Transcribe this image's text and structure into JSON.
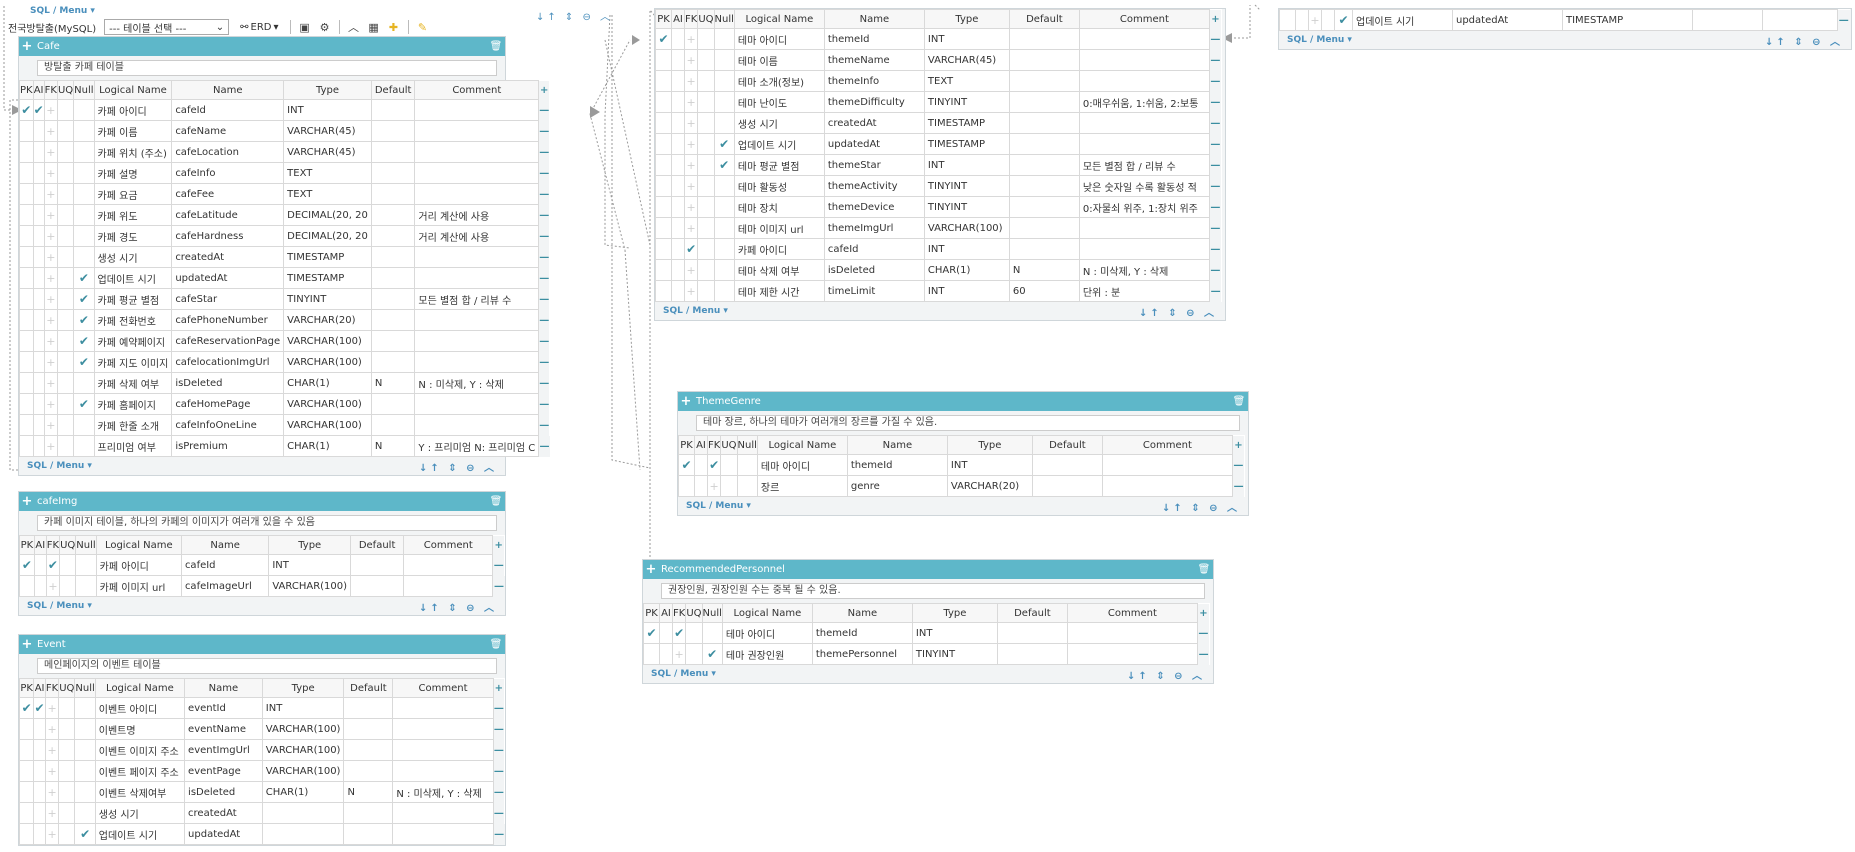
{
  "toolbar": {
    "top_sql_menu": "SQL / Menu",
    "db_label": "전국방탈출(MySQL)",
    "table_select": "--- 테이블 선택 ---",
    "erd_label": "ERD"
  },
  "columns": {
    "pk": "PK",
    "ai": "AI",
    "fk": "FK",
    "uq": "UQ",
    "null": "Null",
    "logical": "Logical Name",
    "name": "Name",
    "type": "Type",
    "default": "Default",
    "comment": "Comment"
  },
  "footer": {
    "sql_menu": "SQL / Menu"
  },
  "tables": {
    "cafe": {
      "name": "Cafe",
      "desc": "방탈출 카페 테이블",
      "rows": [
        {
          "pk": true,
          "ai": true,
          "fk": false,
          "nn": false,
          "logical": "카페 아이디",
          "name": "cafeId",
          "type": "INT",
          "default": "",
          "comment": ""
        },
        {
          "pk": false,
          "ai": false,
          "fk": false,
          "nn": false,
          "logical": "카페 이름",
          "name": "cafeName",
          "type": "VARCHAR(45)",
          "default": "",
          "comment": ""
        },
        {
          "pk": false,
          "ai": false,
          "fk": false,
          "nn": false,
          "logical": "카페 위치 (주소)",
          "name": "cafeLocation",
          "type": "VARCHAR(45)",
          "default": "",
          "comment": ""
        },
        {
          "pk": false,
          "ai": false,
          "fk": false,
          "nn": false,
          "logical": "카페 설명",
          "name": "cafeInfo",
          "type": "TEXT",
          "default": "",
          "comment": ""
        },
        {
          "pk": false,
          "ai": false,
          "fk": false,
          "nn": false,
          "logical": "카페 요금",
          "name": "cafeFee",
          "type": "TEXT",
          "default": "",
          "comment": ""
        },
        {
          "pk": false,
          "ai": false,
          "fk": false,
          "nn": false,
          "logical": "카페 위도",
          "name": "cafeLatitude",
          "type": "DECIMAL(20, 20",
          "default": "",
          "comment": "거리 계산에 사용"
        },
        {
          "pk": false,
          "ai": false,
          "fk": false,
          "nn": false,
          "logical": "카페 경도",
          "name": "cafeHardness",
          "type": "DECIMAL(20, 20",
          "default": "",
          "comment": "거리 계산에 사용"
        },
        {
          "pk": false,
          "ai": false,
          "fk": false,
          "nn": false,
          "logical": "생성 시기",
          "name": "createdAt",
          "type": "TIMESTAMP",
          "default": "",
          "comment": ""
        },
        {
          "pk": false,
          "ai": false,
          "fk": false,
          "nn": true,
          "logical": "업데이트 시기",
          "name": "updatedAt",
          "type": "TIMESTAMP",
          "default": "",
          "comment": ""
        },
        {
          "pk": false,
          "ai": false,
          "fk": false,
          "nn": true,
          "logical": "카페 평균 별점",
          "name": "cafeStar",
          "type": "TINYINT",
          "default": "",
          "comment": "모든 별점 합 / 리뷰 수"
        },
        {
          "pk": false,
          "ai": false,
          "fk": false,
          "nn": true,
          "logical": "카페 전화번호",
          "name": "cafePhoneNumber",
          "type": "VARCHAR(20)",
          "default": "",
          "comment": ""
        },
        {
          "pk": false,
          "ai": false,
          "fk": false,
          "nn": true,
          "logical": "카페 예약페이지",
          "name": "cafeReservationPage",
          "type": "VARCHAR(100)",
          "default": "",
          "comment": ""
        },
        {
          "pk": false,
          "ai": false,
          "fk": false,
          "nn": true,
          "logical": "카페 지도 이미지",
          "name": "cafelocationImgUrl",
          "type": "VARCHAR(100)",
          "default": "",
          "comment": ""
        },
        {
          "pk": false,
          "ai": false,
          "fk": false,
          "nn": false,
          "logical": "카페 삭제 여부",
          "name": "isDeleted",
          "type": "CHAR(1)",
          "default": "N",
          "comment": "N : 미삭제, Y : 삭제"
        },
        {
          "pk": false,
          "ai": false,
          "fk": false,
          "nn": true,
          "logical": "카페 홈페이지",
          "name": "cafeHomePage",
          "type": "VARCHAR(100)",
          "default": "",
          "comment": ""
        },
        {
          "pk": false,
          "ai": false,
          "fk": false,
          "nn": false,
          "logical": "카페 한줄 소개",
          "name": "cafeInfoOneLine",
          "type": "VARCHAR(100)",
          "default": "",
          "comment": ""
        },
        {
          "pk": false,
          "ai": false,
          "fk": false,
          "nn": false,
          "logical": "프리미엄 여부",
          "name": "isPremium",
          "type": "CHAR(1)",
          "default": "N",
          "comment": "Y : 프리미엄 N: 프리미엄 C"
        }
      ]
    },
    "cafeimg": {
      "name": "cafeImg",
      "desc": "카페 이미지 테이블, 하나의 카페의 이미지가 여러개 있을 수 있음",
      "rows": [
        {
          "pk": true,
          "ai": false,
          "fk": true,
          "nn": false,
          "logical": "카페 아이디",
          "name": "cafeId",
          "type": "INT",
          "default": "",
          "comment": ""
        },
        {
          "pk": false,
          "ai": false,
          "fk": false,
          "nn": false,
          "logical": "카페 이미지 url",
          "name": "cafeImageUrl",
          "type": "VARCHAR(100)",
          "default": "",
          "comment": ""
        }
      ]
    },
    "event": {
      "name": "Event",
      "desc": "메인페이지의 이벤트 테이블",
      "rows": [
        {
          "pk": true,
          "ai": true,
          "fk": false,
          "nn": false,
          "logical": "이벤트 아이디",
          "name": "eventId",
          "type": "INT",
          "default": "",
          "comment": ""
        },
        {
          "pk": false,
          "ai": false,
          "fk": false,
          "nn": false,
          "logical": "이벤트명",
          "name": "eventName",
          "type": "VARCHAR(100)",
          "default": "",
          "comment": ""
        },
        {
          "pk": false,
          "ai": false,
          "fk": false,
          "nn": false,
          "logical": "이벤트 이미지 주소",
          "name": "eventImgUrl",
          "type": "VARCHAR(100)",
          "default": "",
          "comment": ""
        },
        {
          "pk": false,
          "ai": false,
          "fk": false,
          "nn": false,
          "logical": "이벤트 페이지 주소",
          "name": "eventPage",
          "type": "VARCHAR(100)",
          "default": "",
          "comment": ""
        },
        {
          "pk": false,
          "ai": false,
          "fk": false,
          "nn": false,
          "logical": "이벤트 삭제여부",
          "name": "isDeleted",
          "type": "CHAR(1)",
          "default": "N",
          "comment": "N : 미삭제, Y : 삭제"
        },
        {
          "pk": false,
          "ai": false,
          "fk": false,
          "nn": false,
          "logical": "생성 시기",
          "name": "createdAt",
          "type": "",
          "default": "",
          "comment": ""
        },
        {
          "pk": false,
          "ai": false,
          "fk": false,
          "nn": true,
          "logical": "업데이트 시기",
          "name": "updatedAt",
          "type": "",
          "default": "",
          "comment": ""
        }
      ]
    },
    "theme": {
      "rows": [
        {
          "pk": true,
          "ai": false,
          "fk": false,
          "nn": false,
          "logical": "테마 아이디",
          "name": "themeId",
          "type": "INT",
          "default": "",
          "comment": ""
        },
        {
          "pk": false,
          "ai": false,
          "fk": false,
          "nn": false,
          "logical": "테마 이름",
          "name": "themeName",
          "type": "VARCHAR(45)",
          "default": "",
          "comment": ""
        },
        {
          "pk": false,
          "ai": false,
          "fk": false,
          "nn": false,
          "logical": "테마 소개(정보)",
          "name": "themeInfo",
          "type": "TEXT",
          "default": "",
          "comment": ""
        },
        {
          "pk": false,
          "ai": false,
          "fk": false,
          "nn": false,
          "logical": "테마 난이도",
          "name": "themeDifficulty",
          "type": "TINYINT",
          "default": "",
          "comment": "0:매우쉬움, 1:쉬움, 2:보통"
        },
        {
          "pk": false,
          "ai": false,
          "fk": false,
          "nn": false,
          "logical": "생성 시기",
          "name": "createdAt",
          "type": "TIMESTAMP",
          "default": "",
          "comment": ""
        },
        {
          "pk": false,
          "ai": false,
          "fk": false,
          "nn": true,
          "logical": "업데이트 시기",
          "name": "updatedAt",
          "type": "TIMESTAMP",
          "default": "",
          "comment": ""
        },
        {
          "pk": false,
          "ai": false,
          "fk": false,
          "nn": true,
          "logical": "테마 평균 별점",
          "name": "themeStar",
          "type": "INT",
          "default": "",
          "comment": "모든 별점 합 / 리뷰 수"
        },
        {
          "pk": false,
          "ai": false,
          "fk": false,
          "nn": false,
          "logical": "테마 활동성",
          "name": "themeActivity",
          "type": "TINYINT",
          "default": "",
          "comment": "낮은 숫자일 수록 활동성 적"
        },
        {
          "pk": false,
          "ai": false,
          "fk": false,
          "nn": false,
          "logical": "테마 장치",
          "name": "themeDevice",
          "type": "TINYINT",
          "default": "",
          "comment": "0:자물쇠 위주, 1:장치 위주"
        },
        {
          "pk": false,
          "ai": false,
          "fk": false,
          "nn": false,
          "logical": "테마 이미지 url",
          "name": "themeImgUrl",
          "type": "VARCHAR(100)",
          "default": "",
          "comment": ""
        },
        {
          "pk": false,
          "ai": false,
          "fk": true,
          "nn": false,
          "logical": "카페 아이디",
          "name": "cafeId",
          "type": "INT",
          "default": "",
          "comment": ""
        },
        {
          "pk": false,
          "ai": false,
          "fk": false,
          "nn": false,
          "logical": "테마 삭제 여부",
          "name": "isDeleted",
          "type": "CHAR(1)",
          "default": "N",
          "comment": "N : 미삭제, Y : 삭제"
        },
        {
          "pk": false,
          "ai": false,
          "fk": false,
          "nn": false,
          "logical": "테마 제한 시간",
          "name": "timeLimit",
          "type": "INT",
          "default": "60",
          "comment": "단위 : 분"
        }
      ]
    },
    "themegenre": {
      "name": "ThemeGenre",
      "desc": "테마 장르, 하나의 테마가 여러개의 장르를 가질 수 있음.",
      "rows": [
        {
          "pk": true,
          "ai": false,
          "fk": true,
          "nn": false,
          "logical": "테마 아이디",
          "name": "themeId",
          "type": "INT",
          "default": "",
          "comment": ""
        },
        {
          "pk": false,
          "ai": false,
          "fk": false,
          "nn": false,
          "logical": "장르",
          "name": "genre",
          "type": "VARCHAR(20)",
          "default": "",
          "comment": ""
        }
      ]
    },
    "recommended": {
      "name": "RecommendedPersonnel",
      "desc": "권장인원, 권장인원 수는 중복 될 수 있음.",
      "rows": [
        {
          "pk": true,
          "ai": false,
          "fk": true,
          "nn": false,
          "logical": "테마 아이디",
          "name": "themeId",
          "type": "INT",
          "default": "",
          "comment": ""
        },
        {
          "pk": false,
          "ai": false,
          "fk": false,
          "nn": true,
          "logical": "테마 권장인원",
          "name": "themePersonnel",
          "type": "TINYINT",
          "default": "",
          "comment": ""
        }
      ]
    },
    "topright": {
      "rows": [
        {
          "pk": false,
          "ai": false,
          "fk": false,
          "nn": true,
          "logical": "업데이트 시기",
          "name": "updatedAt",
          "type": "TIMESTAMP",
          "default": "",
          "comment": ""
        }
      ]
    }
  },
  "colors": {
    "accent": "#5eb7c9",
    "check": "#3d8ea0",
    "link": "#4a8fbc"
  },
  "icons": [
    "plus-icon",
    "trash-icon",
    "check-icon",
    "minus-icon",
    "save-icon",
    "gear-icon",
    "grid-icon",
    "pencil-icon",
    "caret-icon"
  ]
}
